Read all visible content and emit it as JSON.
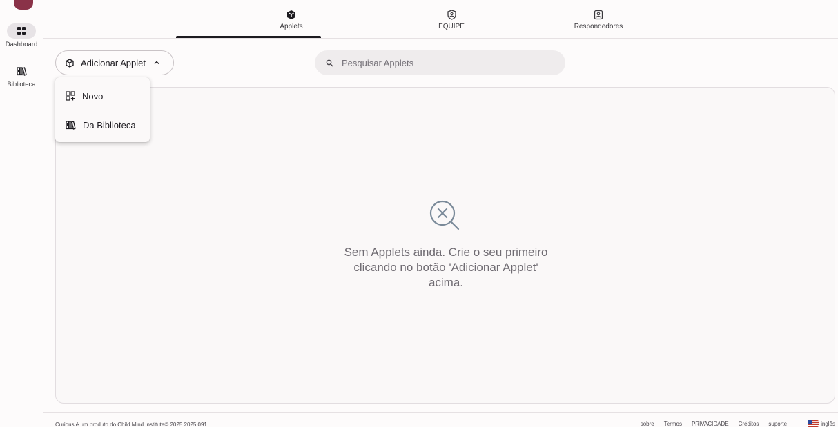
{
  "sidebar": {
    "items": [
      {
        "label": "Dashboard",
        "icon": "dashboard-grid-icon"
      },
      {
        "label": "Biblioteca",
        "icon": "library-icon"
      }
    ]
  },
  "tabs": [
    {
      "label": "Applets",
      "icon": "cube-icon",
      "active": true
    },
    {
      "label": "EQUIPE",
      "icon": "shield-person-icon"
    },
    {
      "label": "Respondedores",
      "icon": "person-badge-icon"
    }
  ],
  "toolbar": {
    "add_label": "Adicionar Applet",
    "search_placeholder": "Pesquisar Applets"
  },
  "menu": {
    "items": [
      {
        "label": "Novo",
        "icon": "new-grid-icon"
      },
      {
        "label": "Da Biblioteca",
        "icon": "library-icon"
      }
    ]
  },
  "empty": {
    "message": "Sem Applets ainda. Crie o seu primeiro clicando no botão 'Adicionar Applet' acima."
  },
  "footer": {
    "credit_prefix": "Curious é um produto do",
    "credit_link": "Child Mind Institute©",
    "credit_suffix": "2025 2025.091",
    "links": [
      "sobre",
      "Termos",
      "PRIVACIDADE",
      "Créditos",
      "suporte"
    ],
    "language": "inglês"
  },
  "colors": {
    "brand": "#8a3248",
    "active_pill": "#e7e3e6",
    "search_bg": "#efeced",
    "empty_text": "#6f6b72",
    "empty_icon": "#7a8a99"
  }
}
